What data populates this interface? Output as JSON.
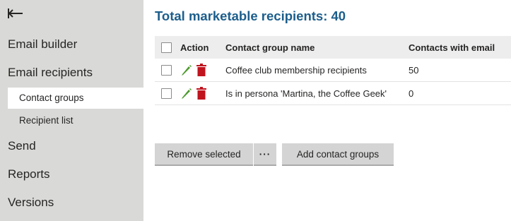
{
  "sidebar": {
    "back_icon": "arrow-left-icon",
    "items": [
      {
        "label": "Email builder"
      },
      {
        "label": "Email recipients"
      },
      {
        "label": "Contact groups",
        "active": true
      },
      {
        "label": "Recipient list"
      },
      {
        "label": "Send"
      },
      {
        "label": "Reports"
      },
      {
        "label": "Versions"
      }
    ]
  },
  "main": {
    "title": "Total marketable recipients: 40",
    "table": {
      "columns": [
        "Action",
        "Contact group name",
        "Contacts with email"
      ],
      "rows": [
        {
          "name": "Coffee club membership recipients",
          "contacts": "50"
        },
        {
          "name": "Is in persona 'Martina, the Coffee Geek'",
          "contacts": "0"
        }
      ]
    },
    "buttons": {
      "remove_selected": "Remove selected",
      "more": "···",
      "add_contact_groups": "Add contact groups"
    }
  },
  "colors": {
    "accent": "#1c5e8c",
    "sidebar_bg": "#d9dad7",
    "edit_icon": "#4a9a2a",
    "delete_icon": "#c0141e"
  }
}
